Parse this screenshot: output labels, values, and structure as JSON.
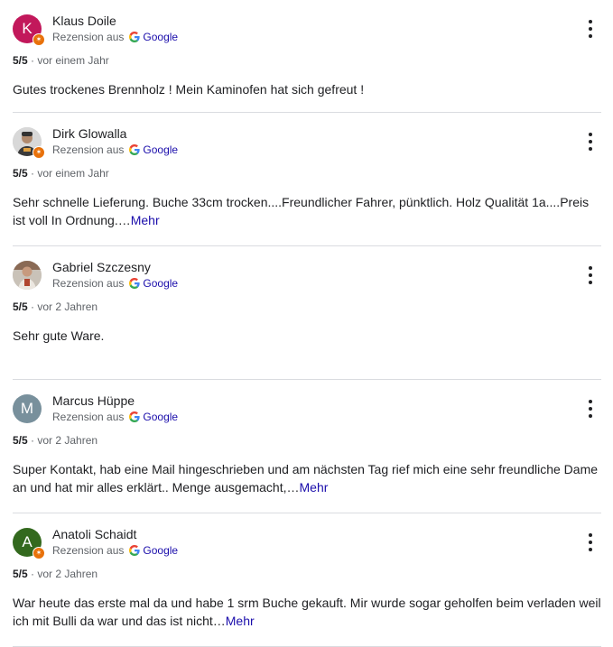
{
  "reviews": [
    {
      "author": "Klaus Doile",
      "avatar_type": "initial",
      "avatar_initial": "K",
      "avatar_color": "#c2185b",
      "source_prefix": "Rezension aus",
      "source_name": "Google",
      "rating": "5/5",
      "time": "vor einem Jahr",
      "text": "Gutes trockenes Brennholz ! Mein Kaminofen hat sich gefreut !",
      "more": ""
    },
    {
      "author": "Dirk Glowalla",
      "avatar_type": "photo",
      "avatar_initial": "",
      "avatar_color": "#9e9e9e",
      "source_prefix": "Rezension aus",
      "source_name": "Google",
      "rating": "5/5",
      "time": "vor einem Jahr",
      "text": "Sehr schnelle Lieferung. Buche 33cm trocken....Freundlicher Fahrer, pünktlich. Holz Qualität 1a....Preis ist voll In Ordnung.…",
      "more": "Mehr"
    },
    {
      "author": "Gabriel Szczesny",
      "avatar_type": "photo",
      "avatar_initial": "",
      "avatar_color": "#9e9e9e",
      "source_prefix": "Rezension aus",
      "source_name": "Google",
      "rating": "5/5",
      "time": "vor 2 Jahren",
      "text": "Sehr gute Ware.",
      "more": ""
    },
    {
      "author": "Marcus Hüppe",
      "avatar_type": "initial",
      "avatar_initial": "M",
      "avatar_color": "#78909c",
      "source_prefix": "Rezension aus",
      "source_name": "Google",
      "rating": "5/5",
      "time": "vor 2 Jahren",
      "text": "Super Kontakt, hab eine Mail hingeschrieben und am nächsten Tag rief mich eine sehr freundliche Dame an und hat mir alles erklärt.. Menge ausgemacht,…",
      "more": "Mehr"
    },
    {
      "author": "Anatoli Schaidt",
      "avatar_type": "initial",
      "avatar_initial": "A",
      "avatar_color": "#33691e",
      "source_prefix": "Rezension aus",
      "source_name": "Google",
      "rating": "5/5",
      "time": "vor 2 Jahren",
      "text": "War heute das erste mal da und habe 1 srm Buche gekauft. Mir wurde sogar geholfen beim verladen weil ich mit Bulli da war und das ist nicht…",
      "more": "Mehr"
    }
  ]
}
